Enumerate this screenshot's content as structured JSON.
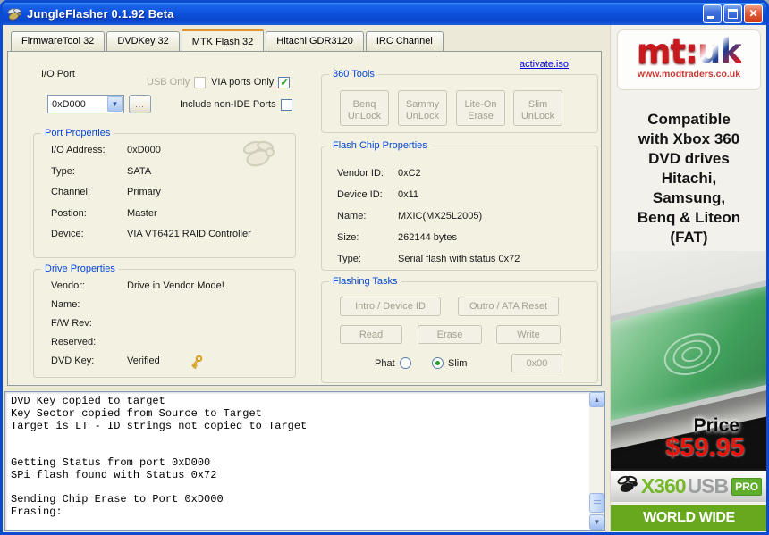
{
  "window": {
    "title": "JungleFlasher 0.1.92 Beta"
  },
  "tabs": {
    "active_index": 2,
    "items": [
      {
        "label": "FirmwareTool 32"
      },
      {
        "label": "DVDKey 32"
      },
      {
        "label": "MTK Flash 32"
      },
      {
        "label": "Hitachi GDR3120"
      },
      {
        "label": "IRC Channel"
      }
    ]
  },
  "page": {
    "activate_link": "activate.iso",
    "io_port": {
      "label": "I/O Port",
      "selected_value": "0xD000",
      "browse_button": "...",
      "usb_only_label": "USB Only",
      "usb_only_checked": false,
      "via_only_label": "VIA ports Only",
      "via_only_checked": true,
      "non_ide_label": "Include non-IDE Ports",
      "non_ide_checked": false
    },
    "tools_360": {
      "title": "360 Tools",
      "buttons": [
        {
          "label": "Benq UnLock"
        },
        {
          "label": "Sammy UnLock"
        },
        {
          "label": "Lite-On Erase"
        },
        {
          "label": "Slim UnLock"
        }
      ]
    },
    "port_properties": {
      "title": "Port Properties",
      "rows": [
        {
          "label": "I/O Address:",
          "value": "0xD000"
        },
        {
          "label": "Type:",
          "value": "SATA"
        },
        {
          "label": "Channel:",
          "value": "Primary"
        },
        {
          "label": "Postion:",
          "value": "Master"
        },
        {
          "label": "Device:",
          "value": "VIA VT6421 RAID Controller"
        }
      ]
    },
    "flash_chip": {
      "title": "Flash Chip Properties",
      "rows": [
        {
          "label": "Vendor ID:",
          "value": "0xC2"
        },
        {
          "label": "Device ID:",
          "value": "0x11"
        },
        {
          "label": "Name:",
          "value": "MXIC(MX25L2005)"
        },
        {
          "label": "Size:",
          "value": "262144 bytes"
        },
        {
          "label": "Type:",
          "value": "Serial flash with status 0x72"
        }
      ]
    },
    "drive_properties": {
      "title": "Drive Properties",
      "rows": [
        {
          "label": "Vendor:",
          "value": "Drive in Vendor Mode!"
        },
        {
          "label": "Name:",
          "value": ""
        },
        {
          "label": "F/W Rev:",
          "value": ""
        },
        {
          "label": "Reserved:",
          "value": ""
        },
        {
          "label": "DVD Key:",
          "value": "Verified"
        }
      ]
    },
    "flashing_tasks": {
      "title": "Flashing Tasks",
      "intro_button": "Intro / Device ID",
      "outro_button": "Outro / ATA Reset",
      "read_button": "Read",
      "erase_button": "Erase",
      "write_button": "Write",
      "phat_label": "Phat",
      "slim_label": "Slim",
      "selected_mode": "Slim",
      "hex_button": "0x00"
    }
  },
  "log": {
    "text": "DVD Key copied to target\nKey Sector copied from Source to Target\nTarget is LT - ID strings not copied to Target\n\n\nGetting Status from port 0xD000\nSPi flash found with Status 0x72\n\nSending Chip Erase to Port 0xD000\nErasing:"
  },
  "ad": {
    "logo": {
      "mt": "mt",
      "colon": ":",
      "uk": "uk",
      "url": "www.modtraders.co.uk"
    },
    "compatibility_lines": [
      "Compatible",
      "with Xbox 360",
      "DVD drives",
      "Hitachi,",
      "Samsung,",
      "Benq & Liteon",
      "(FAT)"
    ],
    "price_label": "Price",
    "price_value": "$59.95",
    "x360usb": {
      "x360": "X360",
      "usb": "USB",
      "pro": "PRO"
    },
    "shipping_banner": "WORLD WIDE SHIPPING"
  }
}
